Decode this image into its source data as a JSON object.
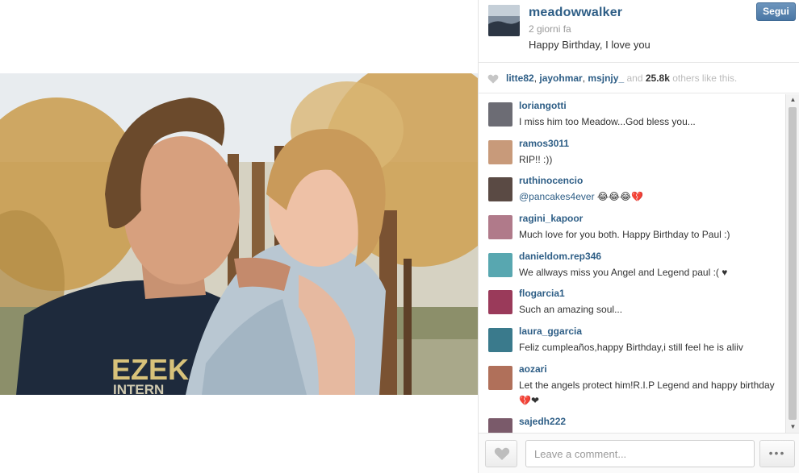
{
  "post": {
    "username": "meadowwalker",
    "time_ago": "2 giorni fa",
    "caption": "Happy Birthday, I love you",
    "follow_label": "Segui"
  },
  "photo": {
    "shirt_text_1": "EZEK",
    "shirt_text_2": "INTERN"
  },
  "likes": {
    "likers": [
      "litte82",
      "jayohmar",
      "msjnjy_"
    ],
    "separator": ",",
    "and_text": "and",
    "count": "25.8k",
    "suffix": "others like this."
  },
  "comments": [
    {
      "user": "loriangotti",
      "text": "I miss him too Meadow...God bless you...",
      "avatar_color": "#6c6c74"
    },
    {
      "user": "ramos3011",
      "text": "RIP!! :))",
      "avatar_color": "#c89a7a"
    },
    {
      "user": "ruthinocencio",
      "mention": "@pancakes4ever",
      "text": " 😂😂😂💔",
      "avatar_color": "#5a4a44"
    },
    {
      "user": "ragini_kapoor",
      "text": "Much love for you both. Happy Birthday to Paul :)",
      "avatar_color": "#b07a8a"
    },
    {
      "user": "danieldom.rep346",
      "text": "We allways miss you Angel and Legend paul :( ♥",
      "avatar_color": "#58a7b0"
    },
    {
      "user": "flogarcia1",
      "text": "Such an amazing soul...",
      "avatar_color": "#9a3a5a"
    },
    {
      "user": "laura_ggarcia",
      "text": "Feliz cumpleaños,happy Birthday,i still feel he is aliiv",
      "avatar_color": "#3a7a8c"
    },
    {
      "user": "aozari",
      "text": "Let the angels protect him!R.I.P Legend and happy birthday 💔❤",
      "avatar_color": "#b0705a"
    },
    {
      "user": "sajedh222",
      "text": "",
      "avatar_color": "#7a5a6a"
    }
  ],
  "comment_bar": {
    "placeholder": "Leave a comment...",
    "more_label": "•••"
  },
  "scrollbar": {
    "up": "▲",
    "down": "▼"
  },
  "colors": {
    "link_blue": "#2e5e86",
    "follow_button": "#4a77a5"
  }
}
